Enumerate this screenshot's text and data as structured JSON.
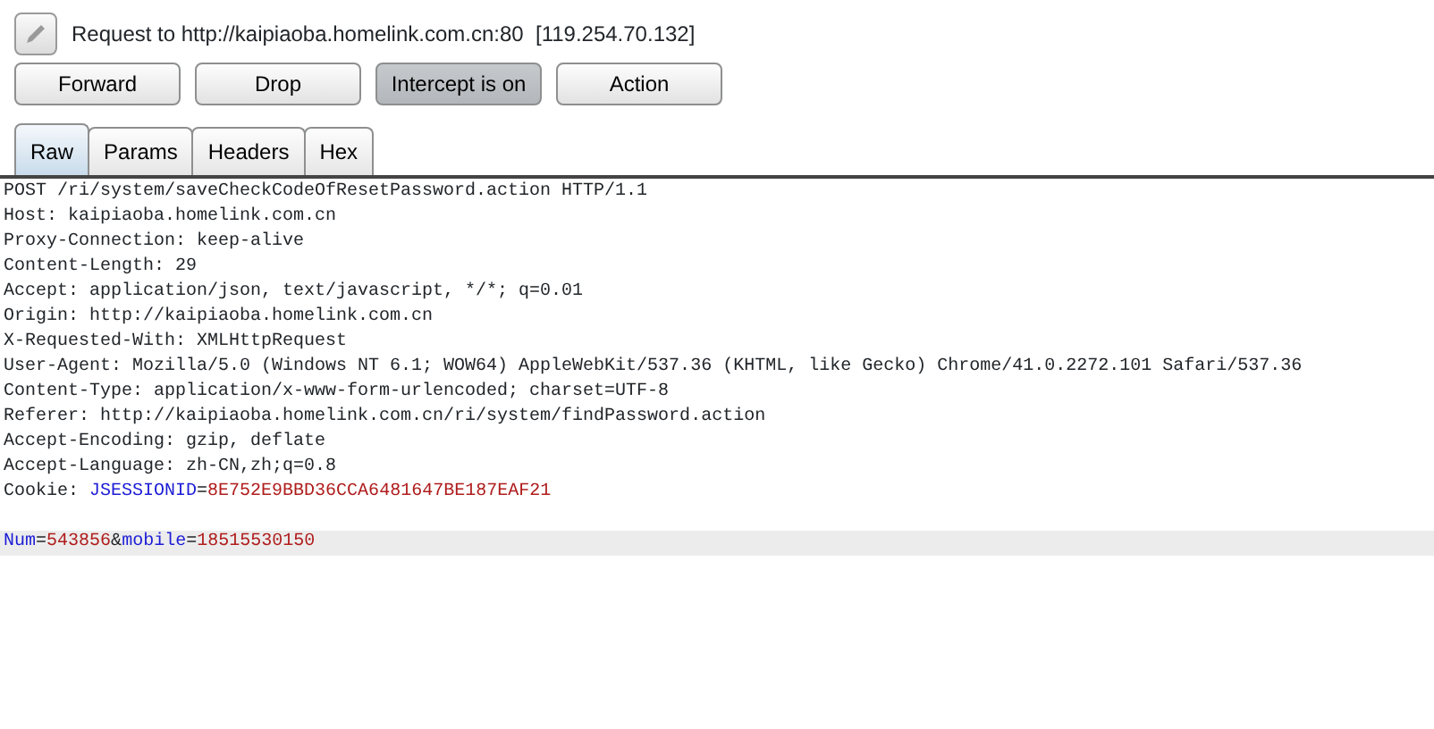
{
  "request_title": "Request to http://kaipiaoba.homelink.com.cn:80  [119.254.70.132]",
  "buttons": [
    {
      "label": "Forward",
      "selected": false
    },
    {
      "label": "Drop",
      "selected": false
    },
    {
      "label": "Intercept is on",
      "selected": true
    },
    {
      "label": "Action",
      "selected": false
    }
  ],
  "tabs": [
    {
      "label": "Raw",
      "selected": true
    },
    {
      "label": "Params",
      "selected": false
    },
    {
      "label": "Headers",
      "selected": false
    },
    {
      "label": "Hex",
      "selected": false
    }
  ],
  "lines": [
    {
      "highlighted": false,
      "segments": [
        {
          "kind": "plain",
          "text": "POST /ri/system/saveCheckCodeOfResetPassword.action HTTP/1.1"
        }
      ]
    },
    {
      "highlighted": false,
      "segments": [
        {
          "kind": "plain",
          "text": "Host: kaipiaoba.homelink.com.cn"
        }
      ]
    },
    {
      "highlighted": false,
      "segments": [
        {
          "kind": "plain",
          "text": "Proxy-Connection: keep-alive"
        }
      ]
    },
    {
      "highlighted": false,
      "segments": [
        {
          "kind": "plain",
          "text": "Content-Length: 29"
        }
      ]
    },
    {
      "highlighted": false,
      "segments": [
        {
          "kind": "plain",
          "text": "Accept: application/json, text/javascript, */*; q=0.01"
        }
      ]
    },
    {
      "highlighted": false,
      "segments": [
        {
          "kind": "plain",
          "text": "Origin: http://kaipiaoba.homelink.com.cn"
        }
      ]
    },
    {
      "highlighted": false,
      "segments": [
        {
          "kind": "plain",
          "text": "X-Requested-With: XMLHttpRequest"
        }
      ]
    },
    {
      "highlighted": false,
      "segments": [
        {
          "kind": "plain",
          "text": "User-Agent: Mozilla/5.0 (Windows NT 6.1; WOW64) AppleWebKit/537.36 (KHTML, like Gecko) Chrome/41.0.2272.101 Safari/537.36"
        }
      ]
    },
    {
      "highlighted": false,
      "segments": [
        {
          "kind": "plain",
          "text": "Content-Type: application/x-www-form-urlencoded; charset=UTF-8"
        }
      ]
    },
    {
      "highlighted": false,
      "segments": [
        {
          "kind": "plain",
          "text": "Referer: http://kaipiaoba.homelink.com.cn/ri/system/findPassword.action"
        }
      ]
    },
    {
      "highlighted": false,
      "segments": [
        {
          "kind": "plain",
          "text": "Accept-Encoding: gzip, deflate"
        }
      ]
    },
    {
      "highlighted": false,
      "segments": [
        {
          "kind": "plain",
          "text": "Accept-Language: zh-CN,zh;q=0.8"
        }
      ]
    },
    {
      "highlighted": false,
      "segments": [
        {
          "kind": "plain",
          "text": "Cookie: "
        },
        {
          "kind": "name",
          "text": "JSESSIONID"
        },
        {
          "kind": "plain",
          "text": "="
        },
        {
          "kind": "value",
          "text": "8E752E9BBD36CCA6481647BE187EAF21"
        }
      ]
    },
    {
      "highlighted": false
    },
    {
      "highlighted": true,
      "segments": [
        {
          "kind": "name",
          "text": "Num"
        },
        {
          "kind": "plain",
          "text": "="
        },
        {
          "kind": "value",
          "text": "543856"
        },
        {
          "kind": "plain",
          "text": "&"
        },
        {
          "kind": "name",
          "text": "mobile"
        },
        {
          "kind": "plain",
          "text": "="
        },
        {
          "kind": "value",
          "text": "18515530150"
        }
      ]
    }
  ]
}
